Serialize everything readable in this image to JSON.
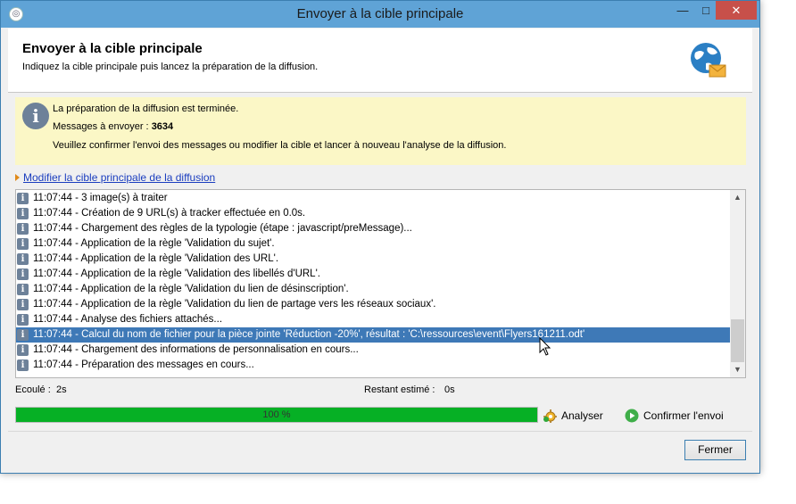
{
  "window": {
    "title": "Envoyer à la cible principale",
    "buttons": {
      "minimize": "—",
      "maximize": "□",
      "close": "✕"
    }
  },
  "header": {
    "title": "Envoyer à la cible principale",
    "subtitle": "Indiquez la cible principale puis lancez la préparation de la diffusion.",
    "icon": "globe-mail-icon"
  },
  "info": {
    "icon": "info-icon",
    "line1": "La préparation de la diffusion est terminée.",
    "messages_label": "Messages à envoyer :",
    "messages_count": "3634",
    "line3": "Veuillez confirmer l'envoi des messages ou modifier la cible et lancer à nouveau l'analyse de la diffusion."
  },
  "modify_link": "Modifier la cible principale de la diffusion",
  "log": {
    "selected_index": 9,
    "rows": [
      "11:07:44 - 3 image(s) à traiter",
      "11:07:44 - Création de 9 URL(s) à tracker effectuée en 0.0s.",
      "11:07:44 - Chargement des règles de la typologie (étape : javascript/preMessage)...",
      "11:07:44 - Application de la règle 'Validation du sujet'.",
      "11:07:44 - Application de la règle 'Validation des URL'.",
      "11:07:44 - Application de la règle 'Validation des libellés d'URL'.",
      "11:07:44 - Application de la règle 'Validation du lien de désinscription'.",
      "11:07:44 - Application de la règle 'Validation du lien de partage vers les réseaux sociaux'.",
      "11:07:44 - Analyse des fichiers attachés...",
      "11:07:44 - Calcul du nom de fichier pour la pièce jointe 'Réduction -20%', résultat : 'C:\\ressources\\event\\Flyers161211.odt'",
      "11:07:44 - Chargement des informations de personnalisation en cours...",
      "11:07:44 - Préparation des messages en cours..."
    ]
  },
  "timing": {
    "elapsed_label": "Ecoulé :",
    "elapsed_value": "2s",
    "remaining_label": "Restant estimé :",
    "remaining_value": "0s"
  },
  "progress": {
    "value": 1.0,
    "label": "100 %",
    "color": "#06b025"
  },
  "actions": {
    "analyze": "Analyser",
    "confirm": "Confirmer l'envoi"
  },
  "close_button": "Fermer"
}
